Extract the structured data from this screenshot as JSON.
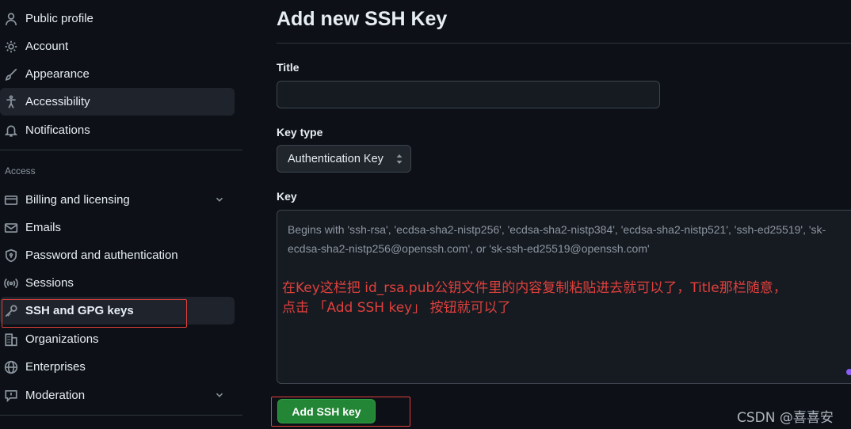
{
  "sidebar": {
    "items_top": [
      {
        "label": "Public profile",
        "icon": "person-icon"
      },
      {
        "label": "Account",
        "icon": "gear-icon"
      },
      {
        "label": "Appearance",
        "icon": "paintbrush-icon"
      },
      {
        "label": "Accessibility",
        "icon": "accessibility-icon",
        "active": true
      },
      {
        "label": "Notifications",
        "icon": "bell-icon"
      }
    ],
    "section_label": "Access",
    "items_access": [
      {
        "label": "Billing and licensing",
        "icon": "credit-card-icon",
        "expandable": true
      },
      {
        "label": "Emails",
        "icon": "mail-icon"
      },
      {
        "label": "Password and authentication",
        "icon": "shield-lock-icon"
      },
      {
        "label": "Sessions",
        "icon": "broadcast-icon"
      },
      {
        "label": "SSH and GPG keys",
        "icon": "key-icon",
        "selected": true
      },
      {
        "label": "Organizations",
        "icon": "organization-icon"
      },
      {
        "label": "Enterprises",
        "icon": "globe-icon"
      },
      {
        "label": "Moderation",
        "icon": "report-icon",
        "expandable": true
      }
    ]
  },
  "main": {
    "page_title": "Add new SSH Key",
    "title_label": "Title",
    "title_value": "",
    "key_type_label": "Key type",
    "key_type_value": "Authentication Key",
    "key_label": "Key",
    "key_placeholder": "Begins with 'ssh-rsa', 'ecdsa-sha2-nistp256', 'ecdsa-sha2-nistp384', 'ecdsa-sha2-nistp521', 'ssh-ed25519', 'sk-ecdsa-sha2-nistp256@openssh.com', or 'sk-ssh-ed25519@openssh.com'",
    "annotation_line1": "在Key这栏把 id_rsa.pub公钥文件里的内容复制粘贴进去就可以了，Title那栏随意，",
    "annotation_line2": "点击 「Add SSH key」 按钮就可以了",
    "submit_label": "Add SSH key"
  },
  "watermark": "CSDN @喜喜安",
  "colors": {
    "background": "#0d1117",
    "accent_green": "#238636",
    "annotation_red": "#e0403c",
    "muted": "#8d96a0"
  }
}
